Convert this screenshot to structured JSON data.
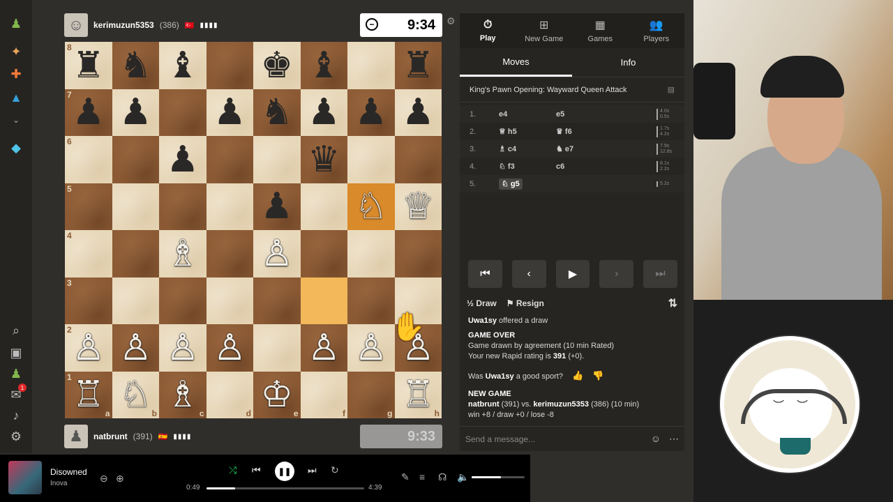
{
  "top_player": {
    "name": "kerimuzun5353",
    "rating": "(386)",
    "flag": "🇹🇷",
    "clock": "9:34"
  },
  "bottom_player": {
    "name": "natbrunt",
    "rating": "(391)",
    "flag": "🇪🇸",
    "clock": "9:33"
  },
  "board": {
    "files": [
      "a",
      "b",
      "c",
      "d",
      "e",
      "f",
      "g",
      "h"
    ],
    "ranks": [
      "8",
      "7",
      "6",
      "5",
      "4",
      "3",
      "2",
      "1"
    ],
    "squares": [
      [
        "♜",
        "♞",
        "♝",
        "",
        "♚",
        "♝",
        "",
        "♜"
      ],
      [
        "♟",
        "♟",
        "",
        "♟",
        "♞",
        "♟",
        "♟",
        "♟"
      ],
      [
        "",
        "",
        "♟",
        "",
        "",
        "♛",
        "",
        ""
      ],
      [
        "",
        "",
        "",
        "",
        "♟",
        "",
        "♘",
        "♕"
      ],
      [
        "",
        "",
        "♗",
        "",
        "♙",
        "",
        "",
        ""
      ],
      [
        "",
        "",
        "",
        "",
        "",
        "",
        "",
        ""
      ],
      [
        "♙",
        "♙",
        "♙",
        "♙",
        "",
        "♙",
        "♙",
        "♙"
      ],
      [
        "♖",
        "♘",
        "♗",
        "",
        "♔",
        "",
        "",
        "♖"
      ]
    ],
    "colors": [
      [
        "b",
        "b",
        "b",
        "",
        "b",
        "b",
        "",
        "b"
      ],
      [
        "b",
        "b",
        "",
        "b",
        "b",
        "b",
        "b",
        "b"
      ],
      [
        "",
        "",
        "b",
        "",
        "",
        "b",
        "",
        ""
      ],
      [
        "",
        "",
        "",
        "",
        "b",
        "",
        "w",
        "w"
      ],
      [
        "",
        "",
        "w",
        "",
        "w",
        "",
        "",
        ""
      ],
      [
        "",
        "",
        "",
        "",
        "",
        "",
        "",
        ""
      ],
      [
        "w",
        "w",
        "w",
        "w",
        "",
        "w",
        "w",
        "w"
      ],
      [
        "w",
        "w",
        "w",
        "",
        "w",
        "",
        "",
        "w"
      ]
    ],
    "highlight": [
      [
        3,
        6
      ],
      [
        5,
        5
      ]
    ]
  },
  "nav": {
    "tabs": [
      {
        "label": "Play",
        "icon": "stopwatch-icon"
      },
      {
        "label": "New Game",
        "icon": "plus-icon"
      },
      {
        "label": "Games",
        "icon": "board-icon"
      },
      {
        "label": "Players",
        "icon": "players-icon"
      }
    ]
  },
  "subtabs": {
    "moves": "Moves",
    "info": "Info"
  },
  "opening": "King's Pawn Opening: Wayward Queen Attack",
  "moves": [
    {
      "num": "1.",
      "white": "e4",
      "black": "e5",
      "t1": "4.0s",
      "t2": "0.5s"
    },
    {
      "num": "2.",
      "white": "♕ h5",
      "black": "♛ f6",
      "t1": "1.7s",
      "t2": "4.2s"
    },
    {
      "num": "3.",
      "white": "♗ c4",
      "black": "♞ e7",
      "t1": "7.9s",
      "t2": "12.8s"
    },
    {
      "num": "4.",
      "white": "♘ f3",
      "black": "c6",
      "t1": "8.1s",
      "t2": "2.2s"
    },
    {
      "num": "5.",
      "white": "♘ g5",
      "black": "",
      "t1": "5.2s",
      "t2": ""
    }
  ],
  "actions": {
    "draw": "Draw",
    "resign": "Resign",
    "half": "½"
  },
  "chat": {
    "offer_user": "Uwa1sy",
    "offer_text": "offered a draw",
    "game_over": "GAME OVER",
    "result": "Game drawn by agreement (10 min Rated)",
    "rating_prefix": "Your new Rapid rating is",
    "rating_value": "391",
    "rating_suffix": "(+0).",
    "sport_prefix": "Was",
    "sport_user": "Uwa1sy",
    "sport_suffix": "a good sport?",
    "new_game": "NEW GAME",
    "ng_white": "natbrunt",
    "ng_white_rating": "(391) vs.",
    "ng_black": "kerimuzun5353",
    "ng_black_rating": "(386) (10 min)",
    "stakes": "win +8 / draw +0 / lose -8",
    "placeholder": "Send a message..."
  },
  "music": {
    "title": "Disowned",
    "artist": "Inova",
    "elapsed": "0:49",
    "total": "4:39",
    "progress": 0.18,
    "volume": 0.55
  }
}
